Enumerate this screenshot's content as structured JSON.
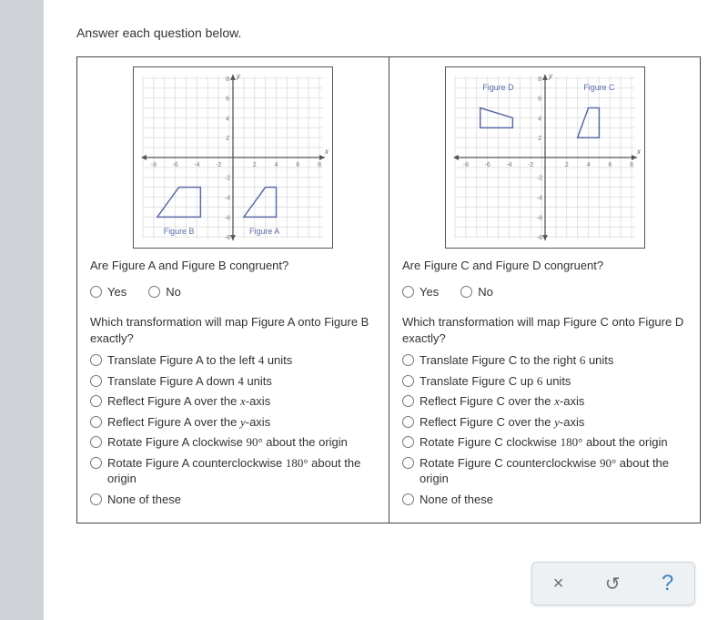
{
  "instruction": "Answer each question below.",
  "graph": {
    "ticks": [
      -8,
      -6,
      -4,
      -2,
      2,
      4,
      6,
      8
    ],
    "axisLabels": {
      "x": "x",
      "y": "y"
    }
  },
  "left": {
    "figALabel": "Figure A",
    "figBLabel": "Figure B",
    "congruentQ": "Are Figure A and Figure B congruent?",
    "yes": "Yes",
    "no": "No",
    "transformQ": "Which transformation will map Figure A onto Figure B exactly?",
    "options": [
      {
        "pre": "Translate Figure A to the left ",
        "num": "4",
        "post": " units"
      },
      {
        "pre": "Translate Figure A down ",
        "num": "4",
        "post": " units"
      },
      {
        "pre": "Reflect Figure A over the ",
        "var": "x",
        "post": "-axis"
      },
      {
        "pre": "Reflect Figure A over the ",
        "var": "y",
        "post": "-axis"
      },
      {
        "pre": "Rotate Figure A clockwise ",
        "num": "90°",
        "post": " about the origin"
      },
      {
        "pre": "Rotate Figure A counterclockwise ",
        "num": "180°",
        "post": " about the origin"
      },
      {
        "pre": "None of these"
      }
    ]
  },
  "right": {
    "figCLabel": "Figure C",
    "figDLabel": "Figure D",
    "congruentQ": "Are Figure C and Figure D congruent?",
    "yes": "Yes",
    "no": "No",
    "transformQ": "Which transformation will map Figure C onto Figure D exactly?",
    "options": [
      {
        "pre": "Translate Figure C to the right ",
        "num": "6",
        "post": " units"
      },
      {
        "pre": "Translate Figure C up ",
        "num": "6",
        "post": " units"
      },
      {
        "pre": "Reflect Figure C over the ",
        "var": "x",
        "post": "-axis"
      },
      {
        "pre": "Reflect Figure C over the ",
        "var": "y",
        "post": "-axis"
      },
      {
        "pre": "Rotate Figure C clockwise ",
        "num": "180°",
        "post": " about the origin"
      },
      {
        "pre": "Rotate Figure C counterclockwise ",
        "num": "90°",
        "post": " about the origin"
      },
      {
        "pre": "None of these"
      }
    ]
  },
  "chart_data": [
    {
      "type": "scatter",
      "title": "Left coordinate plane",
      "xlabel": "x",
      "ylabel": "y",
      "xlim": [
        -9,
        9
      ],
      "ylim": [
        -9,
        9
      ],
      "series": [
        {
          "name": "Figure A",
          "polygon": [
            [
              1,
              -6
            ],
            [
              4,
              -6
            ],
            [
              4,
              -3
            ],
            [
              3,
              -3
            ]
          ]
        },
        {
          "name": "Figure B",
          "polygon": [
            [
              -7,
              -6
            ],
            [
              -3,
              -6
            ],
            [
              -3,
              -3
            ],
            [
              -5,
              -3
            ]
          ]
        }
      ]
    },
    {
      "type": "scatter",
      "title": "Right coordinate plane",
      "xlabel": "x",
      "ylabel": "y",
      "xlim": [
        -9,
        9
      ],
      "ylim": [
        -9,
        9
      ],
      "series": [
        {
          "name": "Figure C",
          "polygon": [
            [
              3,
              2
            ],
            [
              5,
              2
            ],
            [
              5,
              5
            ],
            [
              4,
              5
            ]
          ]
        },
        {
          "name": "Figure D",
          "polygon": [
            [
              -6,
              3
            ],
            [
              -3,
              3
            ],
            [
              -3,
              4
            ],
            [
              -6,
              5
            ]
          ]
        }
      ]
    }
  ],
  "buttons": {
    "close": "×",
    "reset": "↺",
    "help": "?"
  }
}
